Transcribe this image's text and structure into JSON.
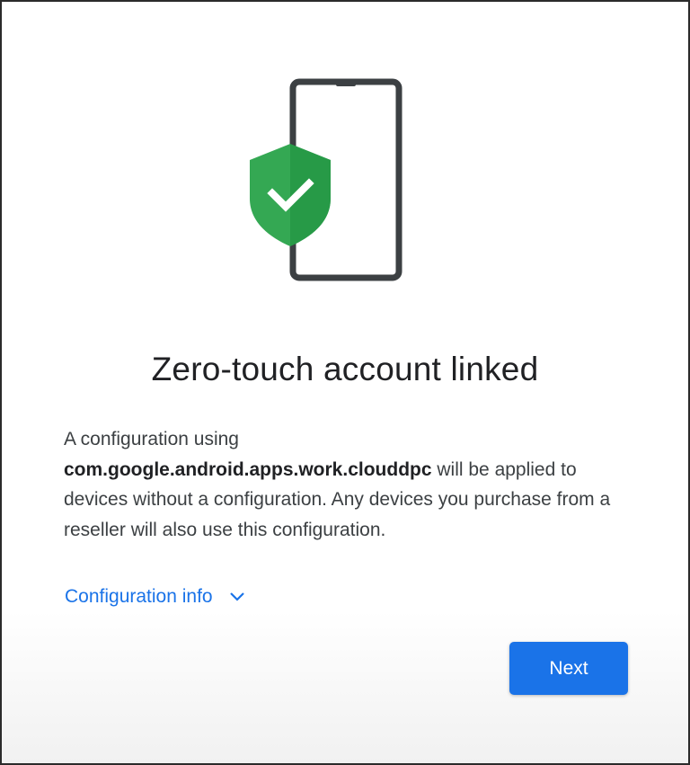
{
  "dialog": {
    "title": "Zero-touch account linked",
    "description": {
      "prefix": "A configuration using",
      "package_name": "com.google.android.apps.work.clouddpc",
      "suffix": "will be applied to devices without a configuration. Any devices you purchase from a reseller will also use this configuration."
    },
    "config_info_label": "Configuration info",
    "next_label": "Next"
  },
  "icons": {
    "illustration": "phone-with-shield-check-icon",
    "expand": "chevron-down-icon"
  },
  "colors": {
    "accent": "#1a73e8",
    "shield": "#34a853",
    "phone_frame": "#3c4043"
  }
}
